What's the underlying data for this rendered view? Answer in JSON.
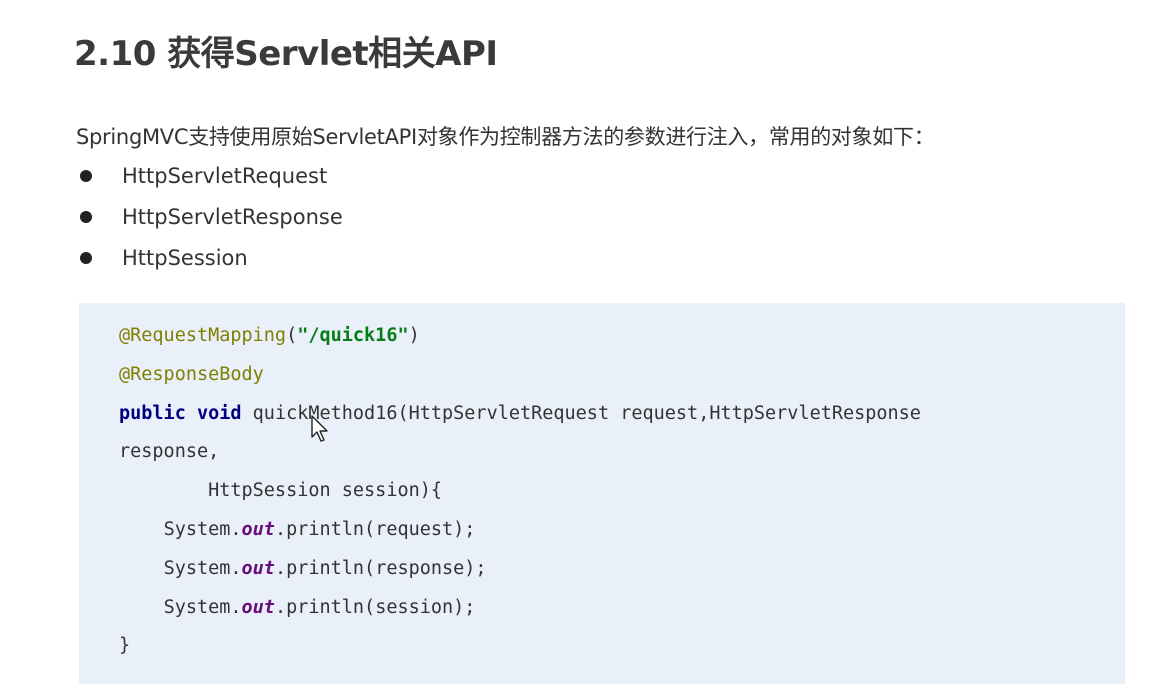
{
  "heading": {
    "title": "2.10 获得Servlet相关API"
  },
  "intro": {
    "text": "SpringMVC支持使用原始ServletAPI对象作为控制器方法的参数进行注入，常用的对象如下："
  },
  "bullets": [
    "HttpServletRequest",
    "HttpServletResponse",
    "HttpSession"
  ],
  "code": {
    "line1": {
      "annotation": "@RequestMapping",
      "open": "(",
      "string": "\"/quick16\"",
      "close": ")"
    },
    "line2": {
      "annotation": "@ResponseBody"
    },
    "line3": {
      "kw1": "public",
      "kw2": "void",
      "rest": "quickMethod16(HttpServletRequest request,HttpServletResponse"
    },
    "line4": {
      "text": "response,"
    },
    "line5": {
      "text": "HttpSession session){"
    },
    "line6": {
      "obj": "System.",
      "field": "out",
      "call": ".println(request);"
    },
    "line7": {
      "obj": "System.",
      "field": "out",
      "call": ".println(response);"
    },
    "line8": {
      "obj": "System.",
      "field": "out",
      "call": ".println(session);"
    },
    "line9": {
      "text": "}"
    }
  },
  "colors": {
    "code_background": "#e9f0f9",
    "annotation": "#808000",
    "string": "#067d17",
    "keyword": "#000080",
    "field": "#660e7a"
  },
  "icons": {
    "cursor": "mouse-pointer-icon"
  }
}
